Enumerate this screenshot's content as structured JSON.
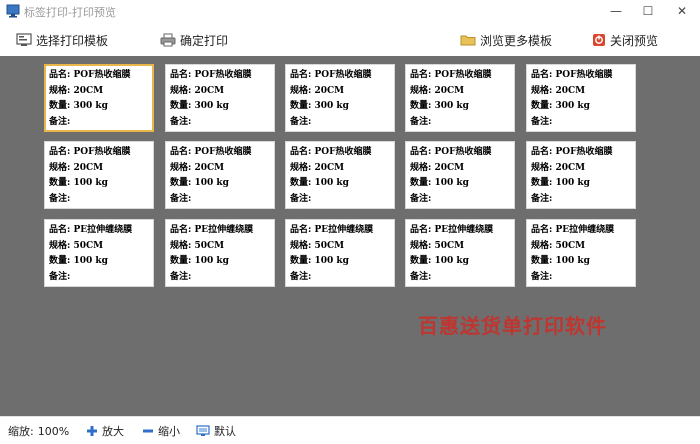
{
  "window": {
    "title": "标签打印-打印预览",
    "minimize": "—",
    "maximize": "☐",
    "close": "✕"
  },
  "toolbar": {
    "select_template": "选择打印模板",
    "confirm_print": "确定打印",
    "browse_templates": "浏览更多模板",
    "close_preview": "关闭预览"
  },
  "labels": [
    {
      "name_key": "品名:",
      "name": "POF热收缩膜",
      "spec_key": "规格:",
      "spec": "20CM",
      "qty_key": "数量:",
      "qty": "300 kg",
      "note_key": "备注:"
    },
    {
      "name_key": "品名:",
      "name": "POF热收缩膜",
      "spec_key": "规格:",
      "spec": "20CM",
      "qty_key": "数量:",
      "qty": "300 kg",
      "note_key": "备注:"
    },
    {
      "name_key": "品名:",
      "name": "POF热收缩膜",
      "spec_key": "规格:",
      "spec": "20CM",
      "qty_key": "数量:",
      "qty": "300 kg",
      "note_key": "备注:"
    },
    {
      "name_key": "品名:",
      "name": "POF热收缩膜",
      "spec_key": "规格:",
      "spec": "20CM",
      "qty_key": "数量:",
      "qty": "300 kg",
      "note_key": "备注:"
    },
    {
      "name_key": "品名:",
      "name": "POF热收缩膜",
      "spec_key": "规格:",
      "spec": "20CM",
      "qty_key": "数量:",
      "qty": "300 kg",
      "note_key": "备注:"
    },
    {
      "name_key": "品名:",
      "name": "POF热收缩膜",
      "spec_key": "规格:",
      "spec": "20CM",
      "qty_key": "数量:",
      "qty": "100 kg",
      "note_key": "备注:"
    },
    {
      "name_key": "品名:",
      "name": "POF热收缩膜",
      "spec_key": "规格:",
      "spec": "20CM",
      "qty_key": "数量:",
      "qty": "100 kg",
      "note_key": "备注:"
    },
    {
      "name_key": "品名:",
      "name": "POF热收缩膜",
      "spec_key": "规格:",
      "spec": "20CM",
      "qty_key": "数量:",
      "qty": "100 kg",
      "note_key": "备注:"
    },
    {
      "name_key": "品名:",
      "name": "POF热收缩膜",
      "spec_key": "规格:",
      "spec": "20CM",
      "qty_key": "数量:",
      "qty": "100 kg",
      "note_key": "备注:"
    },
    {
      "name_key": "品名:",
      "name": "POF热收缩膜",
      "spec_key": "规格:",
      "spec": "20CM",
      "qty_key": "数量:",
      "qty": "100 kg",
      "note_key": "备注:"
    },
    {
      "name_key": "品名:",
      "name": "PE拉伸缠绕膜",
      "spec_key": "规格:",
      "spec": "50CM",
      "qty_key": "数量:",
      "qty": "100 kg",
      "note_key": "备注:"
    },
    {
      "name_key": "品名:",
      "name": "PE拉伸缠绕膜",
      "spec_key": "规格:",
      "spec": "50CM",
      "qty_key": "数量:",
      "qty": "100 kg",
      "note_key": "备注:"
    },
    {
      "name_key": "品名:",
      "name": "PE拉伸缠绕膜",
      "spec_key": "规格:",
      "spec": "50CM",
      "qty_key": "数量:",
      "qty": "100 kg",
      "note_key": "备注:"
    },
    {
      "name_key": "品名:",
      "name": "PE拉伸缠绕膜",
      "spec_key": "规格:",
      "spec": "50CM",
      "qty_key": "数量:",
      "qty": "100 kg",
      "note_key": "备注:"
    },
    {
      "name_key": "品名:",
      "name": "PE拉伸缠绕膜",
      "spec_key": "规格:",
      "spec": "50CM",
      "qty_key": "数量:",
      "qty": "100 kg",
      "note_key": "备注:"
    }
  ],
  "watermark": "百惠送货单打印软件",
  "status": {
    "zoom_label": "缩放:",
    "zoom_value": "100%",
    "zoom_in": "放大",
    "zoom_out": "缩小",
    "reset": "默认"
  },
  "colors": {
    "canvas": "#6e6e6e",
    "selected_border": "#e8b64a",
    "watermark": "#c8302a"
  }
}
